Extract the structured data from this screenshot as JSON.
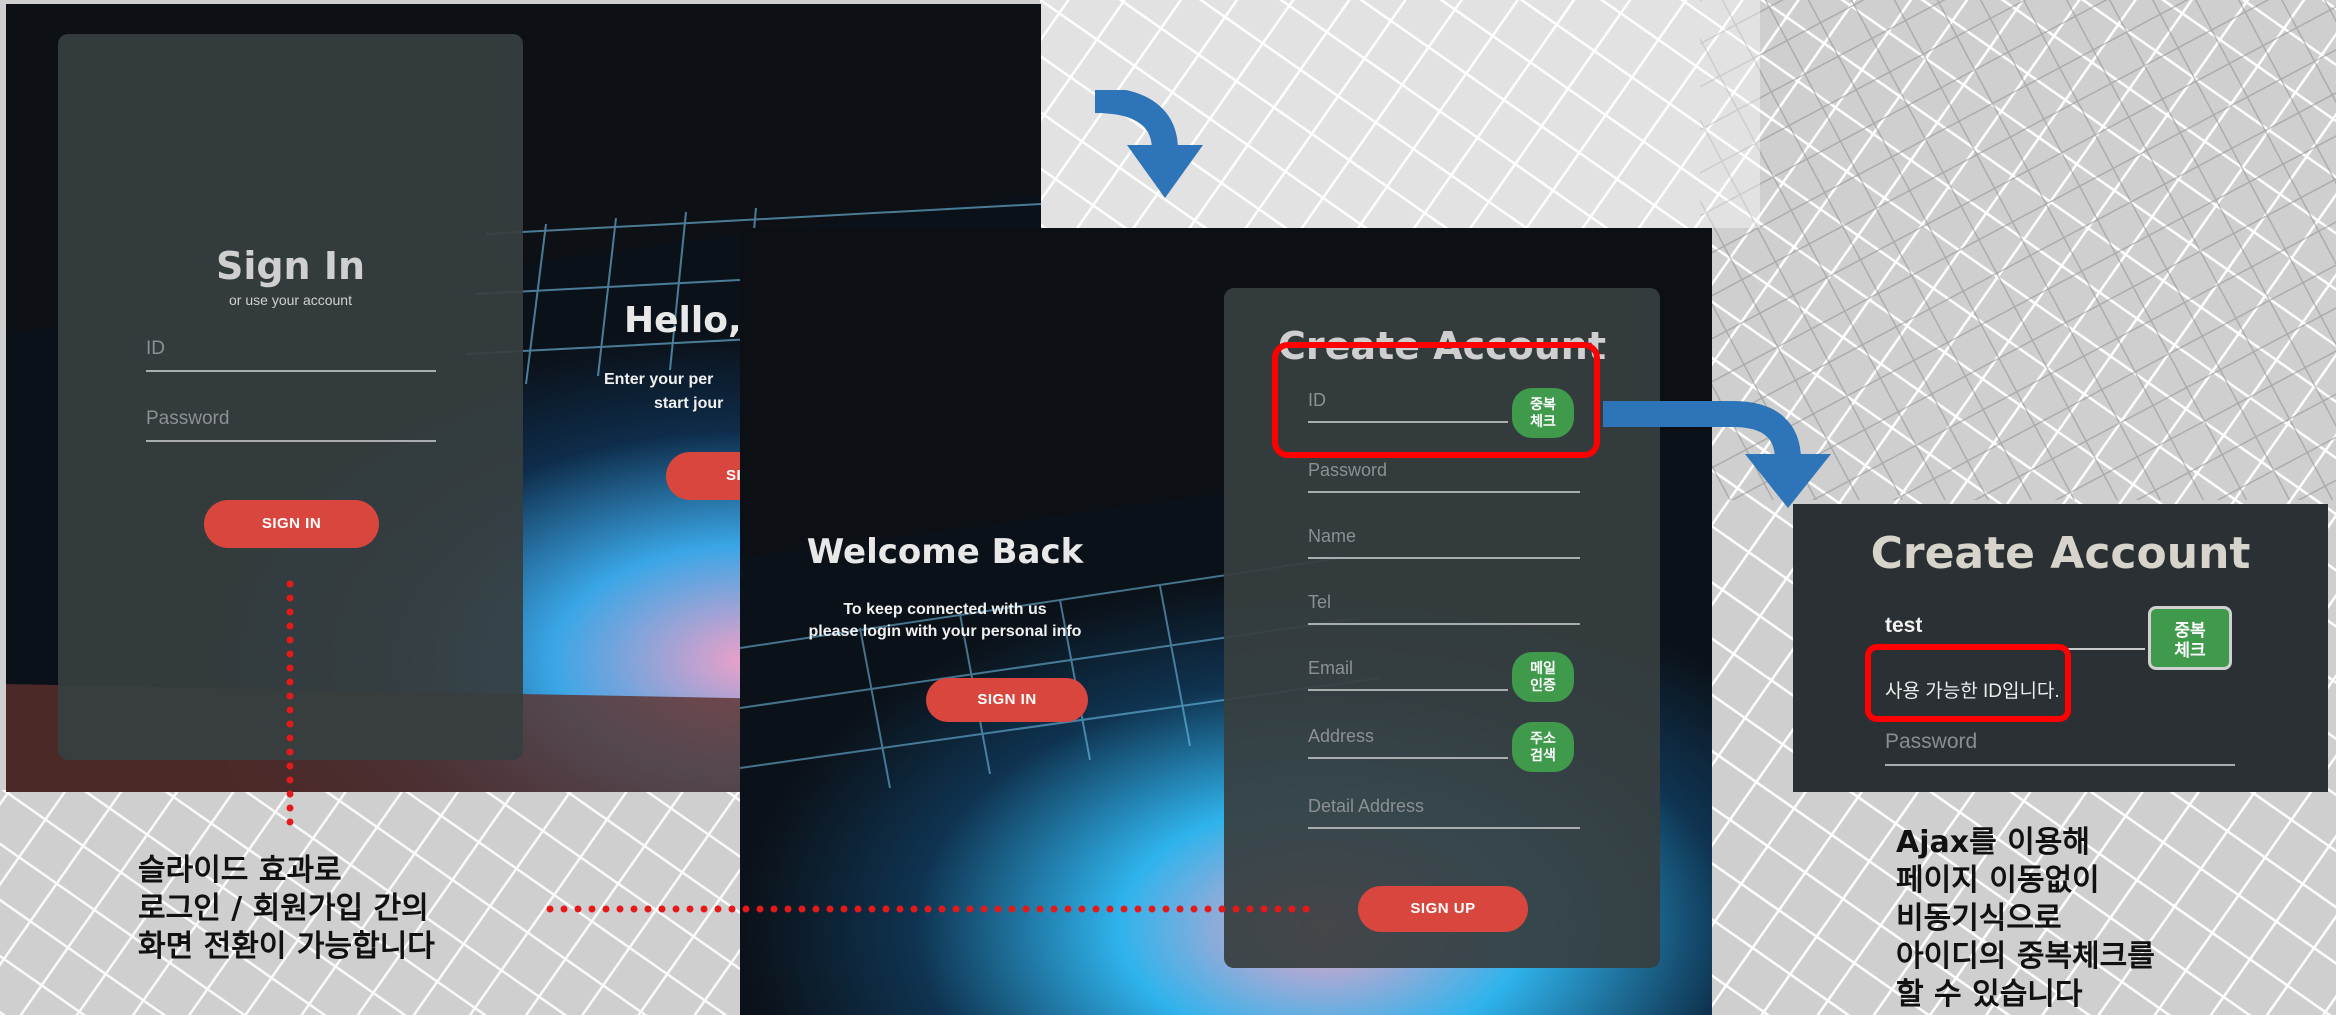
{
  "colors": {
    "accent_red": "#d9463e",
    "dup_green": "#3f9a4c",
    "highlight_red": "#ff0000",
    "arrow_blue": "#2e74b8",
    "dotted_red": "#e41a1a"
  },
  "signin_panel": {
    "title": "Sign In",
    "subtitle": "or use your account",
    "id_placeholder": "ID",
    "password_placeholder": "Password",
    "signin_button": "SIGN IN",
    "overlay_title": "Hello,",
    "overlay_line1": "Enter your per",
    "overlay_line2": "start jour",
    "overlay_button": "SIG"
  },
  "signup_panel": {
    "title": "Create Account",
    "id_placeholder": "ID",
    "dup_check_line1": "중복",
    "dup_check_line2": "체크",
    "password_placeholder": "Password",
    "name_placeholder": "Name",
    "tel_placeholder": "Tel",
    "email_placeholder": "Email",
    "email_verify_line1": "메일",
    "email_verify_line2": "인증",
    "address_placeholder": "Address",
    "address_search_line1": "주소",
    "address_search_line2": "검색",
    "detail_address_placeholder": "Detail Address",
    "signup_button": "SIGN UP",
    "overlay_title": "Welcome Back",
    "overlay_line1": "To keep connected with us",
    "overlay_line2": "please login with your personal info",
    "overlay_button": "SIGN IN"
  },
  "result_panel": {
    "title": "Create Account",
    "id_value": "test",
    "dup_check_line1": "중복",
    "dup_check_line2": "체크",
    "message": "사용 가능한 ID입니다.",
    "password_placeholder": "Password"
  },
  "notes": {
    "slide_line1": "슬라이드 효과로",
    "slide_line2": "로그인 / 회원가입 간의",
    "slide_line3": "화면 전환이 가능합니다",
    "ajax_line1": "Ajax를 이용해",
    "ajax_line2": "페이지 이동없이",
    "ajax_line3": "비동기식으로",
    "ajax_line4": "아이디의 중복체크를",
    "ajax_line5": "할 수 있습니다"
  }
}
